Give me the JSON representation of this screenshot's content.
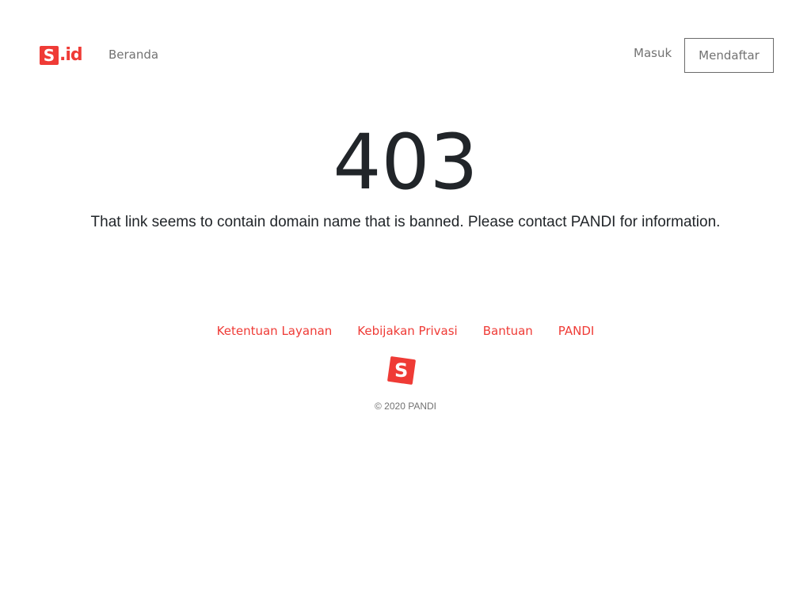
{
  "header": {
    "logo_letter": "S",
    "logo_suffix": ".id",
    "nav_home": "Beranda",
    "login": "Masuk",
    "register": "Mendaftar"
  },
  "main": {
    "error_code": "403",
    "error_message": "That link seems to contain domain name that is banned. Please contact PANDI for information."
  },
  "footer": {
    "links": [
      "Ketentuan Layanan",
      "Kebijakan Privasi",
      "Bantuan",
      "PANDI"
    ],
    "logo_letter": "S",
    "copyright": "© 2020 PANDI"
  },
  "colors": {
    "brand": "#ef3b36",
    "text_dark": "#212529",
    "text_muted": "#727272"
  }
}
